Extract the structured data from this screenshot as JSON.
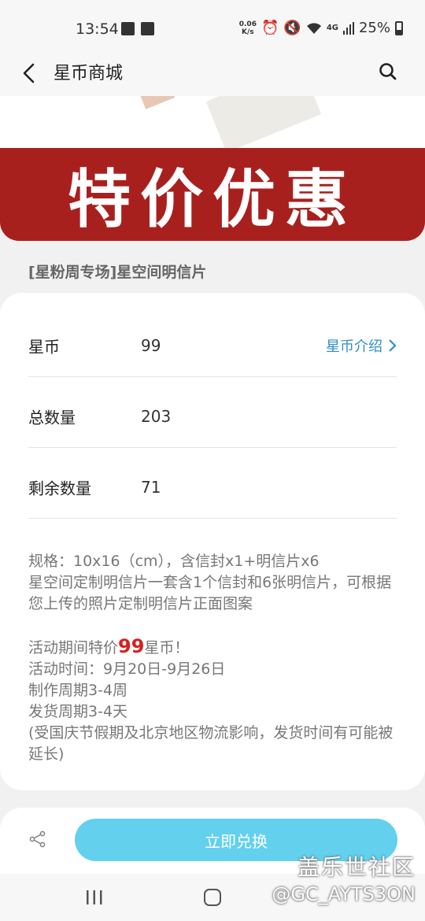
{
  "status_bar": {
    "time": "13:54",
    "net_speed_value": "0.06",
    "net_speed_unit": "K/s",
    "network": "4G",
    "battery": "25%"
  },
  "header": {
    "title": "星币商城"
  },
  "banner": {
    "text": "特价优惠"
  },
  "product": {
    "title": "[星粉周专场]星空间明信片"
  },
  "info_rows": [
    {
      "label": "星币",
      "value": "99",
      "link": "星币介绍"
    },
    {
      "label": "总数量",
      "value": "203"
    },
    {
      "label": "剩余数量",
      "value": "71"
    }
  ],
  "description": {
    "line1": "规格：10x16（cm），含信封x1+明信片x6",
    "line2": "星空间定制明信片一套含1个信封和6张明信片，可根据您上传的照片定制明信片正面图案",
    "promo_prefix": "活动期间特价",
    "promo_price": "99",
    "promo_suffix": "星币！",
    "line4": "活动时间：9月20日-9月26日",
    "line5": "制作周期3-4周",
    "line6": "发货周期3-4天",
    "line7": "(受国庆节假期及北京地区物流影响，发货时间有可能被延长)"
  },
  "bottom": {
    "redeem_label": "立即兑换"
  },
  "watermark": {
    "line1": "盖乐世社区",
    "line2": "@GC_AYTS3ON"
  },
  "colors": {
    "banner_red": "#a8201e",
    "link_blue": "#2f8fc7",
    "button_cyan": "#63d0ee",
    "price_red": "#d81f1f"
  },
  "icons": [
    "back-arrow-icon",
    "search-icon",
    "chevron-right-icon",
    "share-icon",
    "recent-apps-icon",
    "home-icon"
  ]
}
